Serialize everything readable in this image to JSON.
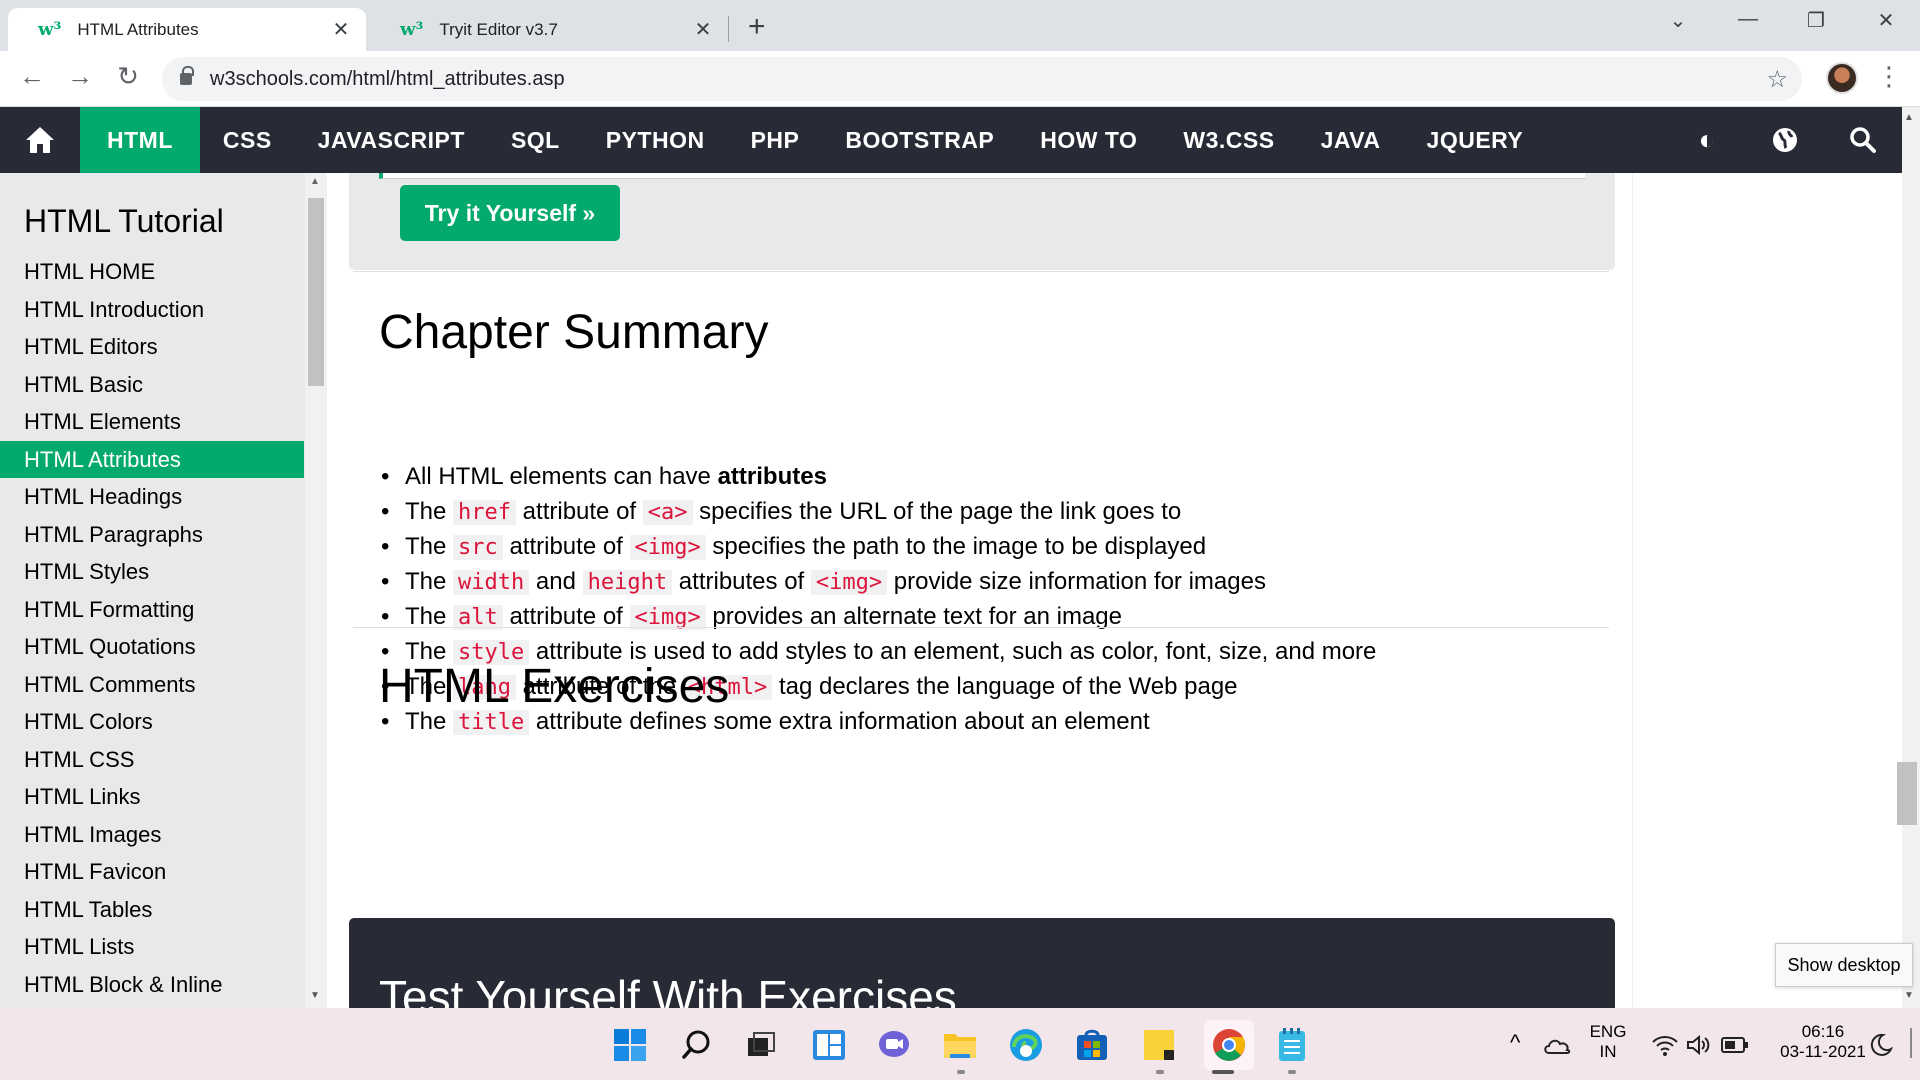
{
  "browser": {
    "tabs": [
      {
        "favicon": "w³",
        "title": "HTML Attributes",
        "close": "✕"
      },
      {
        "favicon": "w³",
        "title": "Tryit Editor v3.7",
        "close": "✕"
      }
    ],
    "new_tab": "+",
    "window_controls": {
      "tab_search": "⌄",
      "minimize": "—",
      "restore": "❐",
      "close": "✕"
    },
    "nav": {
      "back": "←",
      "forward": "→",
      "reload": "↻"
    },
    "url": "w3schools.com/html/html_attributes.asp",
    "star": "☆",
    "menu": "⋮"
  },
  "topnav": {
    "items": [
      "HTML",
      "CSS",
      "JAVASCRIPT",
      "SQL",
      "PYTHON",
      "PHP",
      "BOOTSTRAP",
      "HOW TO",
      "W3.CSS",
      "JAVA",
      "JQUERY"
    ],
    "icons": {
      "theme": "◐",
      "globe": "🌐",
      "search": "🔍"
    }
  },
  "sidebar": {
    "heading": "HTML Tutorial",
    "items": [
      "HTML HOME",
      "HTML Introduction",
      "HTML Editors",
      "HTML Basic",
      "HTML Elements",
      "HTML Attributes",
      "HTML Headings",
      "HTML Paragraphs",
      "HTML Styles",
      "HTML Formatting",
      "HTML Quotations",
      "HTML Comments",
      "HTML Colors",
      "HTML CSS",
      "HTML Links",
      "HTML Images",
      "HTML Favicon",
      "HTML Tables",
      "HTML Lists",
      "HTML Block & Inline"
    ],
    "active_item": "HTML Attributes"
  },
  "main": {
    "try_button": "Try it Yourself »",
    "chapter_heading": "Chapter Summary",
    "summary": [
      [
        {
          "t": "All HTML elements can have "
        },
        {
          "b": "attributes"
        }
      ],
      [
        {
          "t": "The "
        },
        {
          "c": "href"
        },
        {
          "t": " attribute of "
        },
        {
          "c": "<a>"
        },
        {
          "t": " specifies the URL of the page the link goes to"
        }
      ],
      [
        {
          "t": "The "
        },
        {
          "c": "src"
        },
        {
          "t": " attribute of "
        },
        {
          "c": "<img>"
        },
        {
          "t": " specifies the path to the image to be displayed"
        }
      ],
      [
        {
          "t": "The "
        },
        {
          "c": "width"
        },
        {
          "t": " and "
        },
        {
          "c": "height"
        },
        {
          "t": " attributes of "
        },
        {
          "c": "<img>"
        },
        {
          "t": " provide size information for images"
        }
      ],
      [
        {
          "t": "The "
        },
        {
          "c": "alt"
        },
        {
          "t": " attribute of "
        },
        {
          "c": "<img>"
        },
        {
          "t": " provides an alternate text for an image"
        }
      ],
      [
        {
          "t": "The "
        },
        {
          "c": "style"
        },
        {
          "t": " attribute is used to add styles to an element, such as color, font, size, and more"
        }
      ],
      [
        {
          "t": "The "
        },
        {
          "c": "lang"
        },
        {
          "t": " attribute of the "
        },
        {
          "c": "<html>"
        },
        {
          "t": " tag declares the language of the Web page"
        }
      ],
      [
        {
          "t": "The "
        },
        {
          "c": "title"
        },
        {
          "t": " attribute defines some extra information about an element"
        }
      ]
    ],
    "exercises_heading": "HTML Exercises",
    "exercise_box_heading": "Test Yourself With Exercises"
  },
  "tooltip": "Show desktop",
  "taskbar": {
    "language": {
      "line1": "ENG",
      "line2": "IN"
    },
    "time": "06:16",
    "date": "03-11-2021",
    "tray_chevron": "^"
  },
  "colors": {
    "accent": "#04aa6d",
    "nav_bg": "#282a35",
    "sidebar_bg": "#e7e9eb",
    "code": "#dc143c"
  }
}
